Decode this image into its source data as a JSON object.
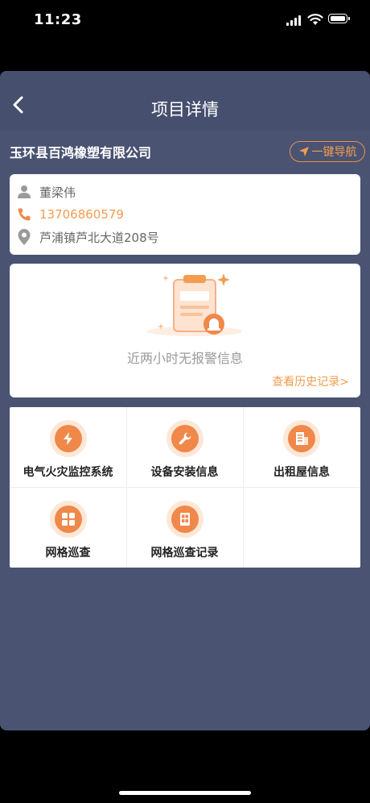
{
  "status_bar": {
    "time": "11:23"
  },
  "header": {
    "title": "项目详情"
  },
  "company": {
    "name": "玉环县百鸿橡塑有限公司",
    "navigate_label": "一键导航"
  },
  "contact": {
    "person": "董梁伟",
    "phone": "13706860579",
    "address": "芦浦镇芦北大道208号"
  },
  "alarm": {
    "message": "近两小时无报警信息",
    "history_link": "查看历史记录>"
  },
  "menu": {
    "items": [
      {
        "label": "电气火灾监控系统",
        "icon": "lightning-icon"
      },
      {
        "label": "设备安装信息",
        "icon": "wrench-icon"
      },
      {
        "label": "出租屋信息",
        "icon": "building-icon"
      },
      {
        "label": "网格巡查",
        "icon": "grid-icon"
      },
      {
        "label": "网格巡查记录",
        "icon": "record-icon"
      }
    ]
  },
  "colors": {
    "accent": "#f39c50",
    "panel": "#4a5372",
    "nav": "#474f6f"
  }
}
